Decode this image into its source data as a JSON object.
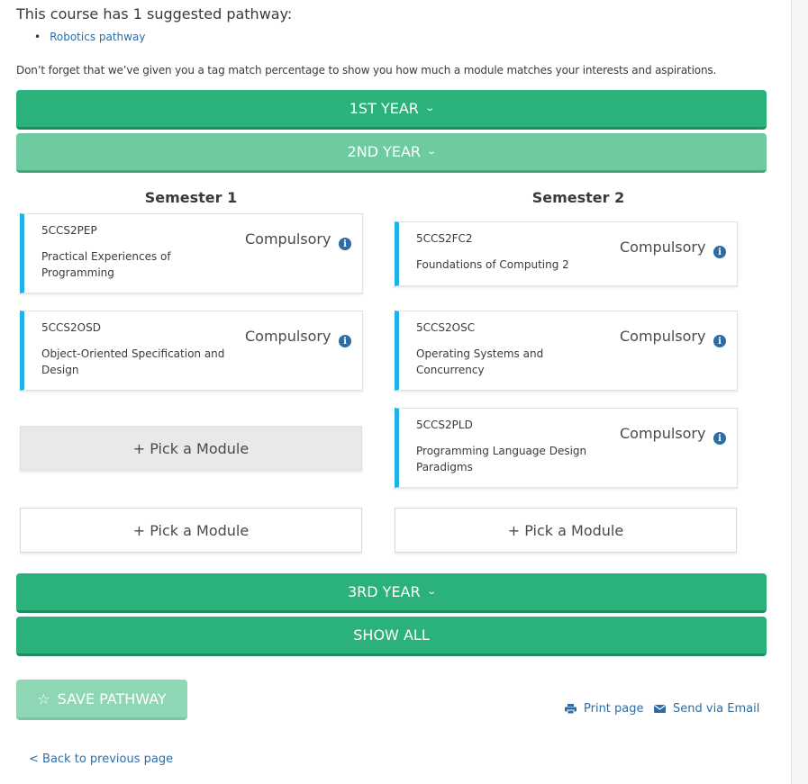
{
  "intro": {
    "title": "This course has 1 suggested pathway:",
    "pathways": [
      "Robotics pathway"
    ],
    "note": "Don’t forget that we’ve given you a tag match percentage to show you how much a module matches your interests and aspirations."
  },
  "years": {
    "first": "1ST YEAR",
    "second": "2ND YEAR",
    "third": "3RD YEAR",
    "show_all": "SHOW ALL",
    "chevron": "⌄"
  },
  "semesters": {
    "s1_title": "Semester 1",
    "s2_title": "Semester 2",
    "s1_modules": [
      {
        "code": "5CCS2PEP",
        "name": "Practical Experiences of Programming",
        "status": "Compulsory"
      },
      {
        "code": "5CCS2OSD",
        "name": "Object-Oriented Specification and Design",
        "status": "Compulsory"
      }
    ],
    "s2_modules": [
      {
        "code": "5CCS2FC2",
        "name": "Foundations of Computing 2",
        "status": "Compulsory"
      },
      {
        "code": "5CCS2OSC",
        "name": "Operating Systems and Concurrency",
        "status": "Compulsory"
      },
      {
        "code": "5CCS2PLD",
        "name": "Programming Language Design Paradigms",
        "status": "Compulsory"
      }
    ],
    "pick_label": "+ Pick a Module"
  },
  "actions": {
    "save": "SAVE PATHWAY",
    "print": "Print page",
    "email": "Send via Email",
    "back": "< Back to previous page"
  },
  "colors": {
    "green": "#2bb27b",
    "green_light": "#6ecb9f",
    "accent_blue": "#1fb3e8",
    "link": "#2e6da4"
  },
  "icons": [
    "star-icon",
    "print-icon",
    "envelope-icon",
    "info-icon",
    "chevron-down-icon"
  ]
}
